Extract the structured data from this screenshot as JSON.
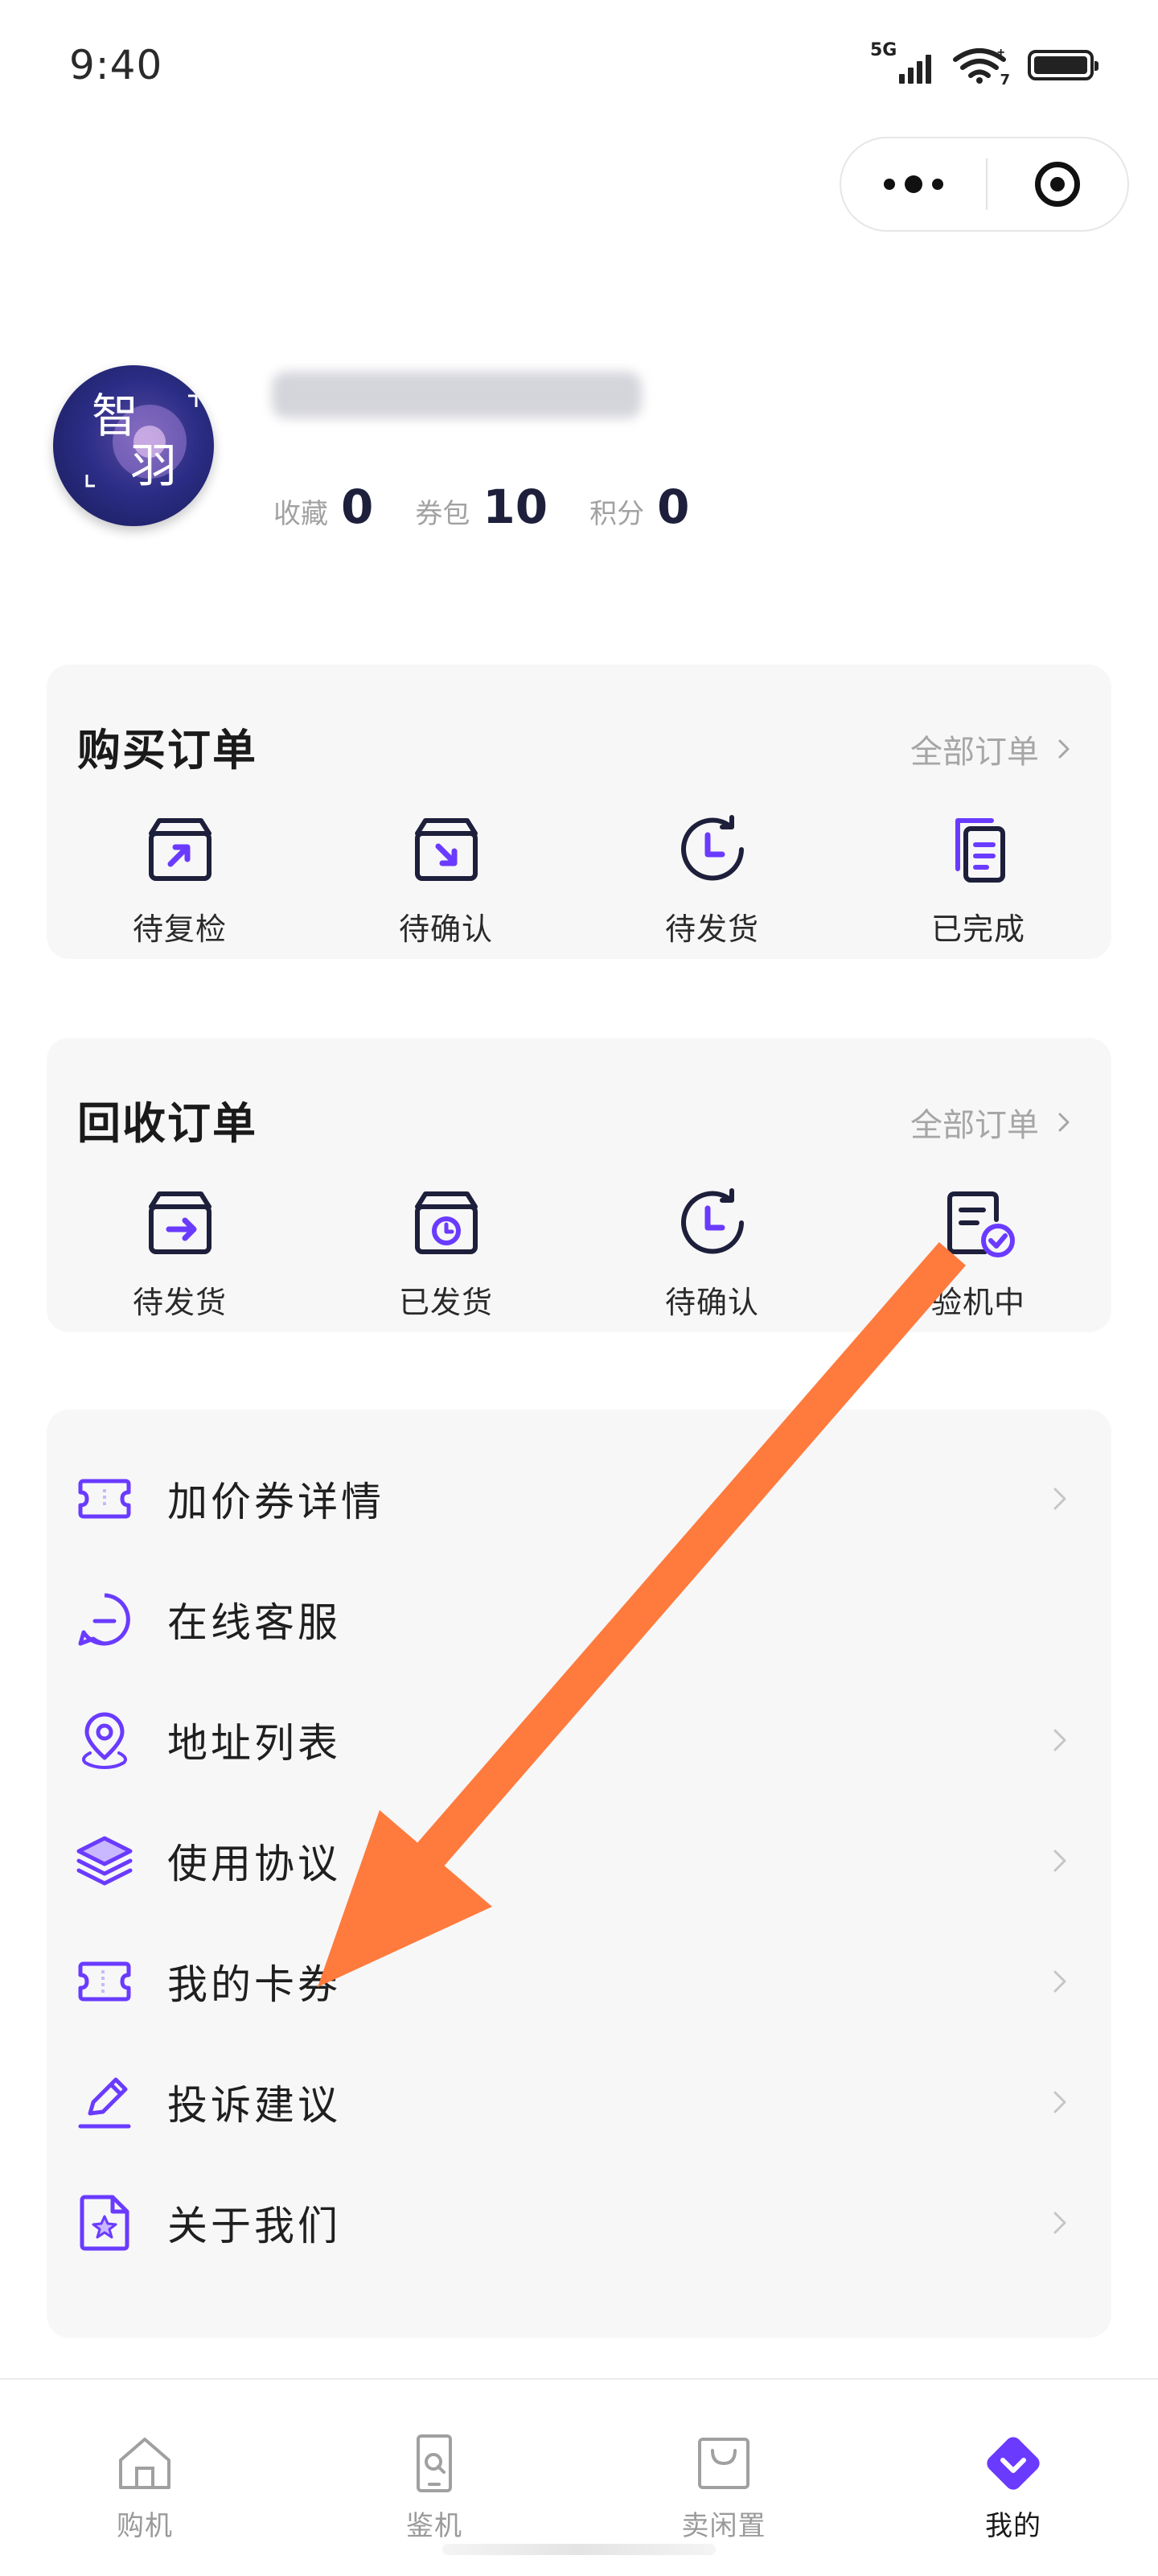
{
  "status_bar": {
    "time": "9:40",
    "network": "5G",
    "wifi_badge": "7"
  },
  "capsule": {
    "icons": [
      "more-dots-icon",
      "close-target-icon"
    ]
  },
  "profile": {
    "avatar_text_top": "智",
    "avatar_text_bottom": "羽",
    "stats": [
      {
        "label": "收藏",
        "value": "0"
      },
      {
        "label": "券包",
        "value": "10"
      },
      {
        "label": "积分",
        "value": "0"
      }
    ]
  },
  "purchase_orders": {
    "title": "购买订单",
    "view_all": "全部订单",
    "items": [
      {
        "label": "待复检",
        "icon": "box-arrow-out-icon"
      },
      {
        "label": "待确认",
        "icon": "box-arrow-in-icon"
      },
      {
        "label": "待发货",
        "icon": "clock-icon"
      },
      {
        "label": "已完成",
        "icon": "document-stack-icon"
      }
    ]
  },
  "recycle_orders": {
    "title": "回收订单",
    "view_all": "全部订单",
    "items": [
      {
        "label": "待发货",
        "icon": "box-send-icon"
      },
      {
        "label": "已发货",
        "icon": "box-clock-icon"
      },
      {
        "label": "待确认",
        "icon": "clock-icon"
      },
      {
        "label": "验机中",
        "icon": "document-check-icon"
      }
    ]
  },
  "menu": [
    {
      "label": "加价券详情",
      "icon": "ticket-icon",
      "chevron": true
    },
    {
      "label": "在线客服",
      "icon": "chat-bubble-icon",
      "chevron": false
    },
    {
      "label": "地址列表",
      "icon": "location-pin-icon",
      "chevron": true
    },
    {
      "label": "使用协议",
      "icon": "layers-icon",
      "chevron": true
    },
    {
      "label": "我的卡券",
      "icon": "coupon-icon",
      "chevron": true
    },
    {
      "label": "投诉建议",
      "icon": "pencil-icon",
      "chevron": true
    },
    {
      "label": "关于我们",
      "icon": "star-document-icon",
      "chevron": true
    }
  ],
  "tabbar": [
    {
      "label": "购机",
      "icon": "home-icon",
      "active": false
    },
    {
      "label": "鉴机",
      "icon": "phone-inspect-icon",
      "active": false
    },
    {
      "label": "卖闲置",
      "icon": "shopping-bag-icon",
      "active": false
    },
    {
      "label": "我的",
      "icon": "profile-heart-icon",
      "active": true
    }
  ],
  "colors": {
    "accent": "#6a3bff",
    "arrow": "#ff7a3d",
    "card_bg": "#f7f7f7",
    "text_primary": "#1f1f1f",
    "text_muted": "#a6a6a6"
  }
}
